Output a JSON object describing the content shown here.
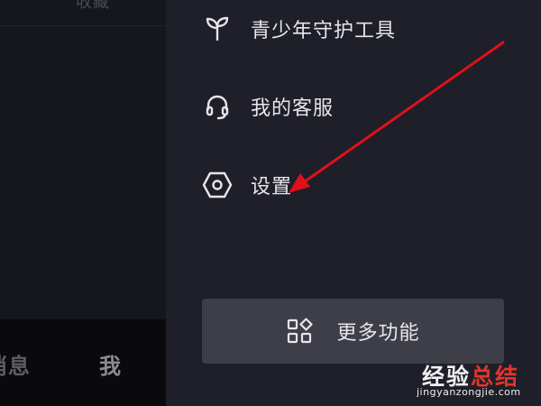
{
  "left_pane": {
    "top_text": "收藏",
    "tabs": {
      "messages": "消息",
      "me": "我"
    }
  },
  "drawer": {
    "items": [
      {
        "label": "青少年守护工具",
        "icon": "sprout-icon"
      },
      {
        "label": "我的客服",
        "icon": "headset-icon"
      },
      {
        "label": "设置",
        "icon": "hexagon-gear-icon"
      }
    ],
    "more_button": {
      "label": "更多功能",
      "icon": "grid-apps-icon"
    }
  },
  "annotation": {
    "color": "#e0101a",
    "points_to": "设置"
  },
  "watermark": {
    "title_part1": "经验",
    "title_part2": "总结",
    "url": "jingyanzongjie.com"
  }
}
